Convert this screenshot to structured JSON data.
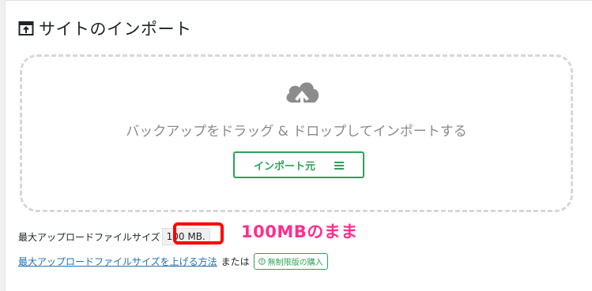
{
  "header": {
    "title": "サイトのインポート",
    "icon": "import-icon"
  },
  "dropzone": {
    "icon": "cloud-upload-icon",
    "text": "バックアップをドラッグ & ドロップしてインポートする",
    "button_label": "インポート元",
    "button_icon": "menu-icon"
  },
  "size_info": {
    "label": "最大アップロードファイルサイズ",
    "value": "100 MB."
  },
  "annotation": {
    "text": "100MBのまま",
    "color": "#ff2d8f",
    "box_color": "#ff0000"
  },
  "links": {
    "increase_label": "最大アップロードファイルサイズを上げる方法",
    "or_text": "または",
    "buy_label": "無制限版の購入",
    "buy_icon": "info-icon"
  },
  "colors": {
    "accent_green": "#2ea15a",
    "link_blue": "#2271b1"
  }
}
